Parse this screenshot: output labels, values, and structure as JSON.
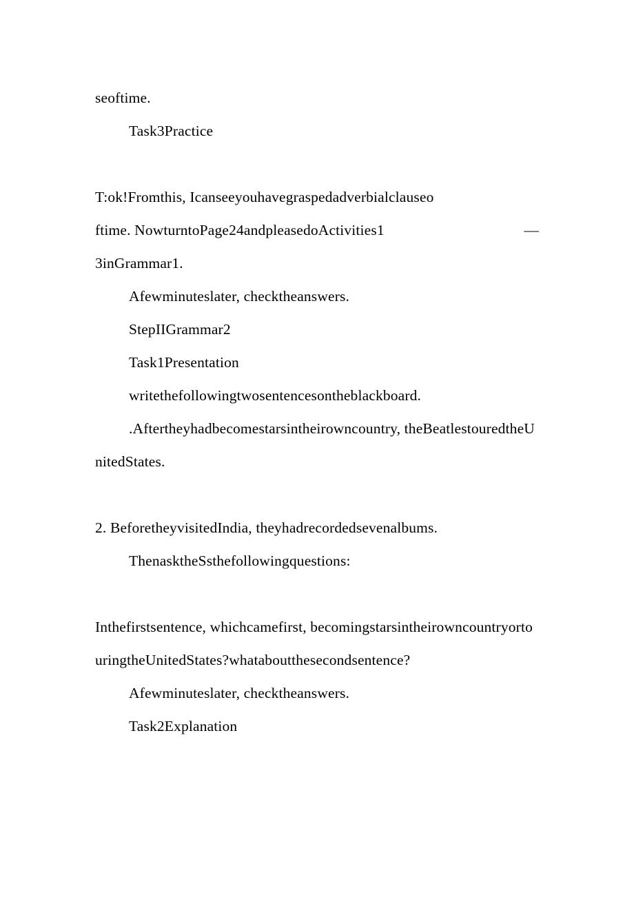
{
  "document": {
    "page_background": "#ffffff",
    "text_color": "#000000",
    "blocks": [
      {
        "id": "b1",
        "name": "paragraph-seoftime",
        "indent": false,
        "justify": false,
        "text": "seoftime."
      },
      {
        "id": "b2",
        "name": "paragraph-task3-practice",
        "indent": true,
        "justify": false,
        "text": "Task3Practice"
      },
      {
        "id": "gap1",
        "name": "blank-line-1",
        "spacer": true,
        "text": ""
      },
      {
        "id": "b3",
        "name": "paragraph-teacher-ok-grasped-adverbial-clause",
        "indent": false,
        "justify": true,
        "text": "T:ok!Fromthis, Icanseeyouhavegraspedadverbialclauseoftime. NowturntoPage24andpleasedoActivities1　3inGrammar1.",
        "line1": "T:ok!Fromthis, Icanseeyouhavegraspedadverbialclauseo",
        "line2_text": "ftime. NowturntoPage24andpleasedoActivities1",
        "line2_trailing": "—",
        "line3": "3inGrammar1."
      },
      {
        "id": "b4",
        "name": "paragraph-check-the-answers-1",
        "indent": true,
        "justify": false,
        "text": "Afewminuteslater, checktheanswers."
      },
      {
        "id": "b5",
        "name": "paragraph-step-2-grammar-2",
        "indent": true,
        "justify": false,
        "text": "StepIIGrammar2"
      },
      {
        "id": "b6",
        "name": "paragraph-task1-presentation",
        "indent": true,
        "justify": false,
        "text": "Task1Presentation"
      },
      {
        "id": "b7",
        "name": "paragraph-write-two-sentences-blackboard",
        "indent": true,
        "justify": false,
        "text": "writethefollowingtwosentencesontheblackboard."
      },
      {
        "id": "b8",
        "name": "paragraph-sentence-1-beatles-toured",
        "indent": true,
        "justify": false,
        "text": ".Aftertheyhadbecomestarsintheirowncountry, theBeatlestouredtheUnitedStates."
      },
      {
        "id": "gap2",
        "name": "blank-line-2",
        "spacer": true,
        "text": ""
      },
      {
        "id": "b9",
        "name": "paragraph-sentence-2-recorded-seven-albums",
        "indent": false,
        "justify": false,
        "text": "2. BeforetheyvisitedIndia, theyhadrecordedsevenalbums."
      },
      {
        "id": "b10",
        "name": "paragraph-then-ask-ss-questions",
        "indent": true,
        "justify": false,
        "text": "ThenasktheSsthefollowingquestions:"
      },
      {
        "id": "gap3",
        "name": "blank-line-3",
        "spacer": true,
        "text": ""
      },
      {
        "id": "b11",
        "name": "paragraph-which-came-first-question",
        "indent": false,
        "justify": false,
        "text": "Inthefirstsentence, whichcamefirst, becomingstarsintheirowncountryortouringtheUnitedStates?whataboutthesecondsentence?"
      },
      {
        "id": "b12",
        "name": "paragraph-check-the-answers-2",
        "indent": true,
        "justify": false,
        "text": "Afewminuteslater, checktheanswers."
      },
      {
        "id": "b13",
        "name": "paragraph-task2-explanation",
        "indent": true,
        "justify": false,
        "text": "Task2Explanation"
      }
    ]
  }
}
